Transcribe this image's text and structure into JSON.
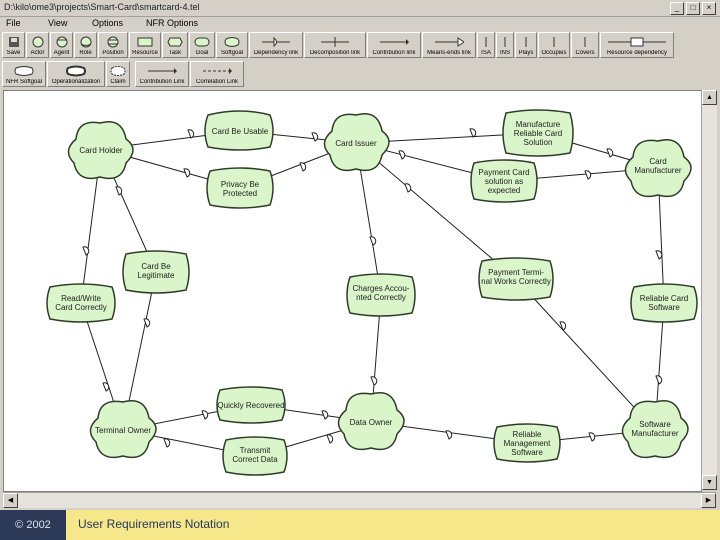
{
  "window": {
    "title": "D:\\kilo\\ome3\\projects\\Smart-Card\\smartcard-4.tel",
    "controls": [
      "_",
      "□",
      "×"
    ]
  },
  "menu": [
    "File",
    "View",
    "Options",
    "NFR Options"
  ],
  "toolbar_row1": [
    "Save",
    "Actor",
    "Agent",
    "Role",
    "Position",
    "Resource",
    "Task",
    "Goal",
    "Softgoal",
    "Dependency link",
    "Decomposition link",
    "Contribution link",
    "Means-ends link",
    "ISA",
    "INS",
    "Plays",
    "Occupies",
    "Covers",
    "Resource dependency"
  ],
  "toolbar_row2": [
    "NFR Softgoal",
    "Operationalization",
    "Claim",
    "Contribution Link",
    "Correlation Link"
  ],
  "diagram": {
    "actors": [
      "Card Holder",
      "Card Issuer",
      "Card Manufacturer",
      "Terminal Owner",
      "Data Owner",
      "Software Manufacturer"
    ],
    "softgoals": [
      "Card Be Usable",
      "Privacy Be Protected",
      "Card Be Legitimate",
      "Read/Write Card Correctly",
      "Manufacture Reliable Card Solution",
      "Payment Card solution as expected",
      "Charges Accounted Correctly",
      "Payment Terminal Works Correctly",
      "Reliable Card Software",
      "Quickly Recovered",
      "Transmit Correct Data",
      "Reliable Management Software"
    ]
  },
  "footer": {
    "copyright": "© 2002",
    "title": "User Requirements Notation"
  },
  "colors": {
    "node_fill": "#d9f5c9",
    "node_stroke": "#2f3b2a",
    "footer_left": "#2c3a57",
    "footer_right": "#f6e88a"
  }
}
